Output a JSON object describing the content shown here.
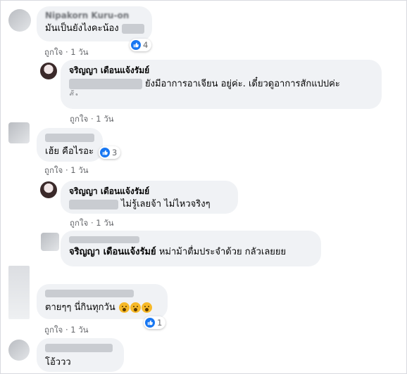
{
  "actions": {
    "like_label": "ถูกใจ",
    "separator": "·",
    "time": "1 วัน"
  },
  "comments": [
    {
      "name": "Nipakorn Kuru-on",
      "text": "มันเป็นยังไงคะน้อง",
      "reactions": "4"
    },
    {
      "name": "จริญญา เดือนแจ้งรัมย์",
      "text": "ยังมีอาการอาเจียน อยู่ค่ะ. เดี๋ยวดูอาการสักแปปค่ะ",
      "text_line2": "ยั้ง"
    },
    {
      "text": "เฮ้ย คือไรอะ",
      "reactions": "3"
    },
    {
      "name": "จริญญา เดือนแจ้งรัมย์",
      "text": "ไม่รู้เลยจ้า ไม่ไหวจริงๆ"
    },
    {
      "name": "จริญญา เดือนแจ้งรัมย์",
      "text": "หม่าม้าตื่มประจำด้วย กลัวเลยยย"
    },
    {
      "text": "ตายๆๆ นี่กินทุกวัน",
      "reactions": "1"
    },
    {
      "text": "โอ้ววว"
    }
  ],
  "icons": {
    "like": "thumbs-up-icon",
    "emoji": "scream-emoji-icon"
  },
  "colors": {
    "bubble": "#f0f2f5",
    "meta": "#65676b",
    "like_blue": "#1877f2",
    "border": "#d8dadf"
  }
}
